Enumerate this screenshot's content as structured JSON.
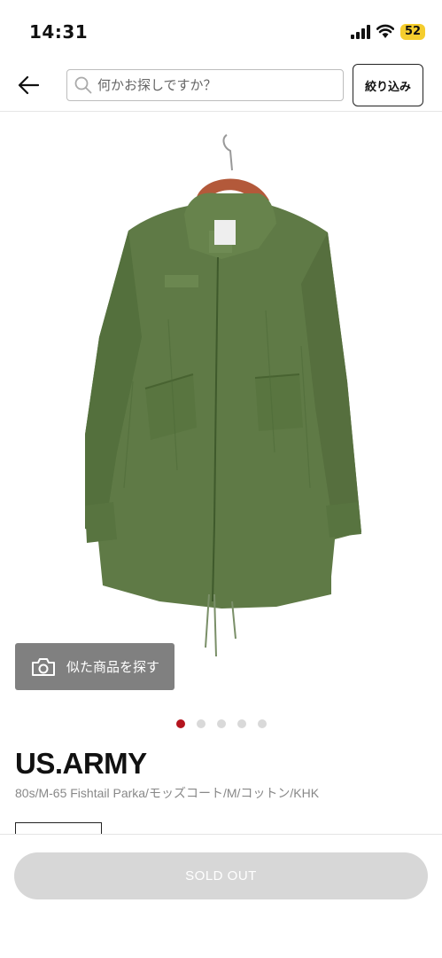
{
  "status_bar": {
    "time": "14:31",
    "battery": "52"
  },
  "header": {
    "search_placeholder": "何かお探しですか？",
    "filter_label": "絞り込み"
  },
  "gallery": {
    "similar_label": "似た商品を探す",
    "total_images": 5,
    "active_index": 0,
    "accent_color": "#b4141e"
  },
  "product": {
    "brand": "US.ARMY",
    "title": "80s/M-65 Fishtail Parka/モッズコート/M/コットン/KHK"
  },
  "footer": {
    "sold_out_label": "SOLD OUT"
  },
  "icons": [
    "signal-icon",
    "wifi-icon",
    "back-arrow-icon",
    "search-icon",
    "camera-icon"
  ]
}
